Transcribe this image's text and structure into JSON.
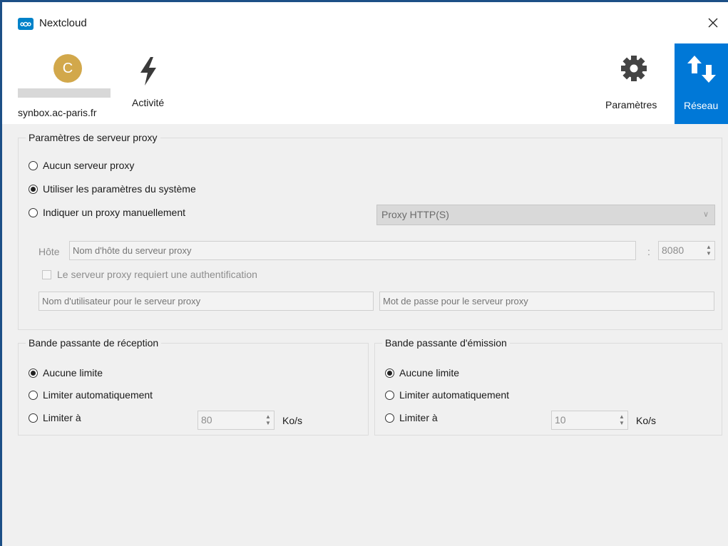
{
  "window": {
    "title": "Nextcloud",
    "close_icon": "close-icon"
  },
  "toolbar": {
    "account": {
      "avatar_letter": "C",
      "host": "synbox.ac-paris.fr",
      "avatar_color": "#d2a84b"
    },
    "activity_label": "Activité",
    "settings_label": "Paramètres",
    "network_label": "Réseau",
    "active_color": "#0078d7"
  },
  "proxy": {
    "title": "Paramètres de serveur proxy",
    "options": [
      {
        "label": "Aucun serveur proxy",
        "selected": false
      },
      {
        "label": "Utiliser les paramètres du système",
        "selected": true
      },
      {
        "label": "Indiquer un proxy manuellement",
        "selected": false
      }
    ],
    "type_value": "Proxy HTTP(S)",
    "host_label": "Hôte",
    "host_placeholder": "Nom d'hôte du serveur proxy",
    "port_separator": ":",
    "port_value": "8080",
    "auth_label": "Le serveur proxy requiert une authentification",
    "auth_checked": false,
    "user_placeholder": "Nom d'utilisateur pour le serveur proxy",
    "password_placeholder": "Mot de passe pour le serveur proxy"
  },
  "download": {
    "title": "Bande passante de réception",
    "options": [
      {
        "label": "Aucune limite",
        "selected": true
      },
      {
        "label": "Limiter automatiquement",
        "selected": false
      },
      {
        "label": "Limiter à",
        "selected": false
      }
    ],
    "limit_value": "80",
    "unit": "Ko/s"
  },
  "upload": {
    "title": "Bande passante d'émission",
    "options": [
      {
        "label": "Aucune limite",
        "selected": true
      },
      {
        "label": "Limiter automatiquement",
        "selected": false
      },
      {
        "label": "Limiter à",
        "selected": false
      }
    ],
    "limit_value": "10",
    "unit": "Ko/s"
  }
}
